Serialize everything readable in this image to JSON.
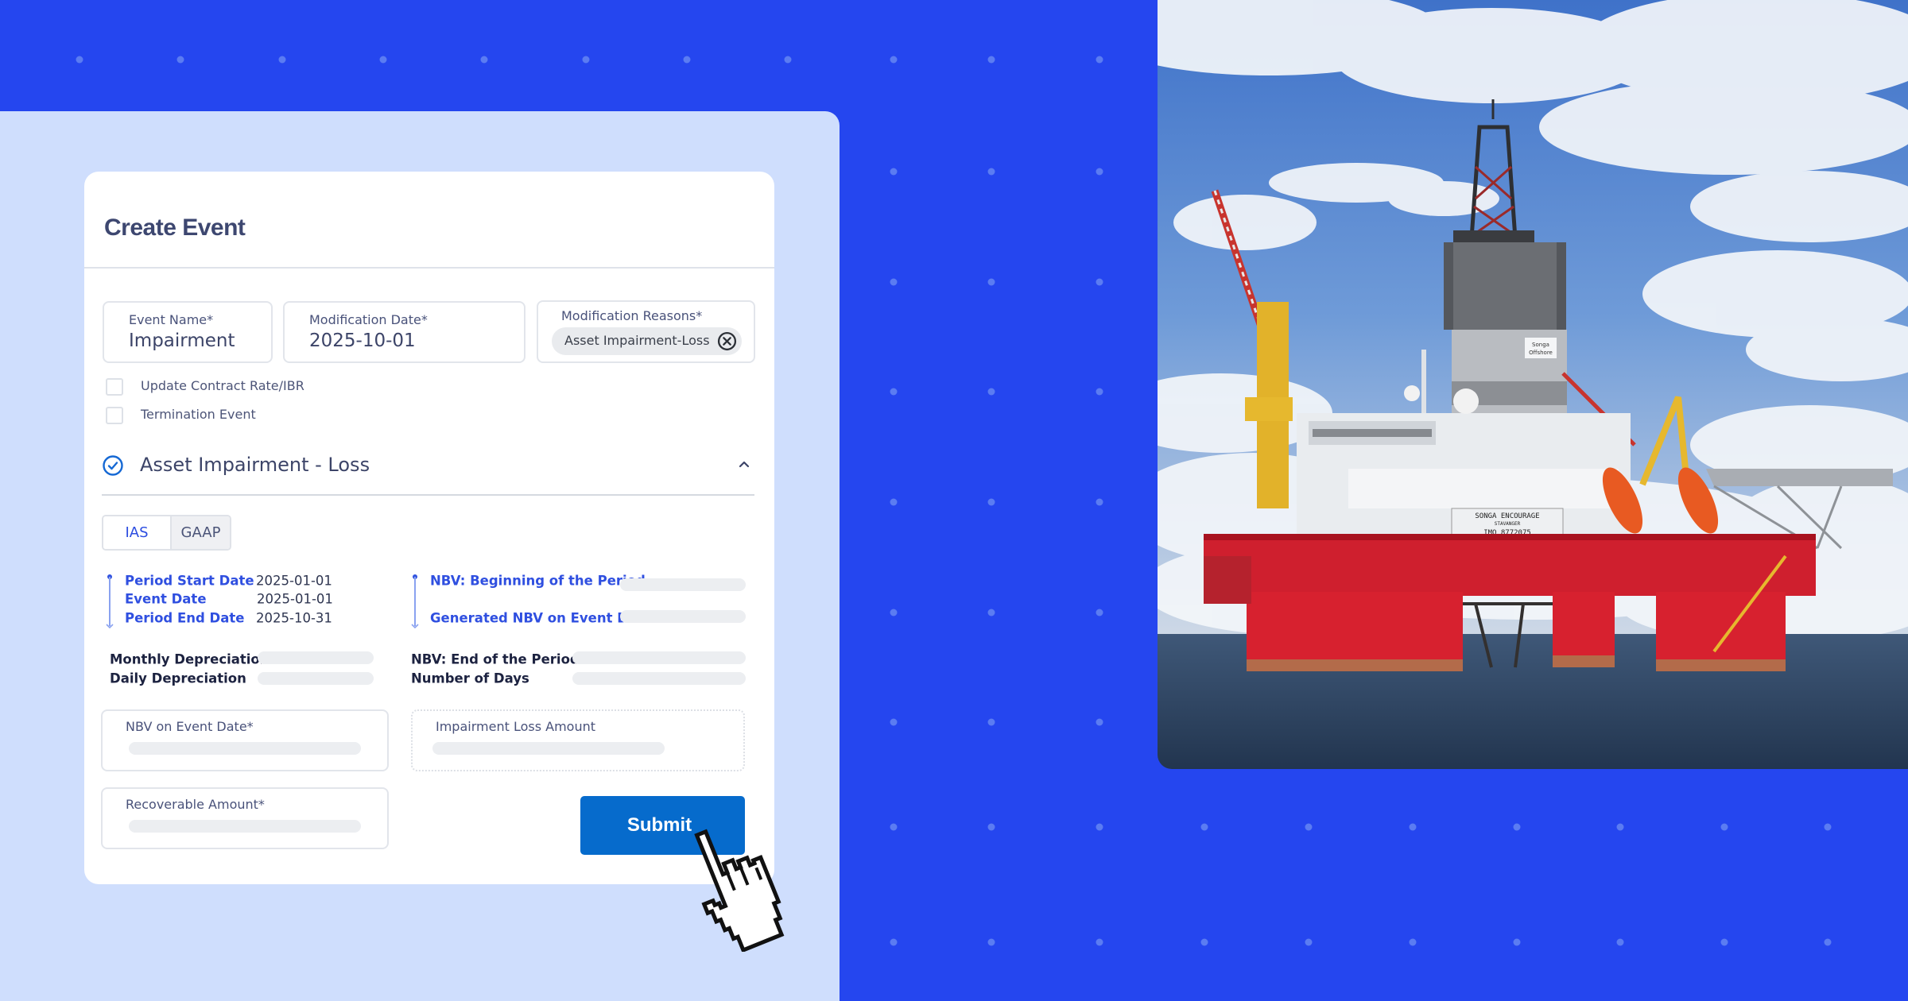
{
  "background": {
    "brand_color": "#2546ef",
    "panel_color": "#cfdefd",
    "dot_color": "#5b7cf2"
  },
  "form": {
    "title": "Create Event",
    "fields": {
      "event_name": {
        "label": "Event Name*",
        "value": "Impairment"
      },
      "modification_date": {
        "label": "Modification Date*",
        "value": "2025-10-01"
      },
      "modification_reasons": {
        "label": "Modification Reasons*",
        "chips": [
          "Asset Impairment-Loss"
        ]
      }
    },
    "checkboxes": [
      {
        "label": "Update Contract Rate/IBR",
        "checked": false
      },
      {
        "label": "Termination Event",
        "checked": false
      }
    ],
    "section": {
      "title": "Asset Impairment - Loss",
      "status_icon": "check-circle-icon",
      "expanded": true,
      "standards_toggle": {
        "options": [
          "IAS",
          "GAAP"
        ],
        "selected": "IAS"
      },
      "timeline_left": [
        {
          "label": "Period Start Date",
          "value": "2025-01-01"
        },
        {
          "label": "Event Date",
          "value": "2025-01-01"
        },
        {
          "label": "Period End Date",
          "value": "2025-10-31"
        }
      ],
      "timeline_right": [
        {
          "label": "NBV: Beginning of the Period",
          "value": ""
        },
        {
          "label": "Generated NBV on Event Date",
          "value": ""
        }
      ],
      "stats_left": [
        {
          "label": "Monthly Depreciation",
          "value": ""
        },
        {
          "label": "Daily Depreciation",
          "value": ""
        }
      ],
      "stats_right": [
        {
          "label": "NBV: End of the Period",
          "value": ""
        },
        {
          "label": "Number of Days",
          "value": ""
        }
      ],
      "inputs": [
        {
          "label": "NBV on Event Date*",
          "value": ""
        },
        {
          "label": "Impairment Loss Amount",
          "value": "",
          "readonly": true
        },
        {
          "label": "Recoverable Amount*",
          "value": ""
        }
      ]
    },
    "submit_label": "Submit",
    "submit_color": "#066bcc",
    "accent_color": "#2f4fe0"
  },
  "photo": {
    "subject": "Semi-submersible offshore drilling rig at sea",
    "hull_text": [
      "SONGA ENCOURAGE",
      "STAVANGER",
      "IMO 8772075"
    ],
    "tower_logo": [
      "Songa",
      "Offshore"
    ]
  },
  "cursor": {
    "icon": "hand-pointer-icon"
  }
}
